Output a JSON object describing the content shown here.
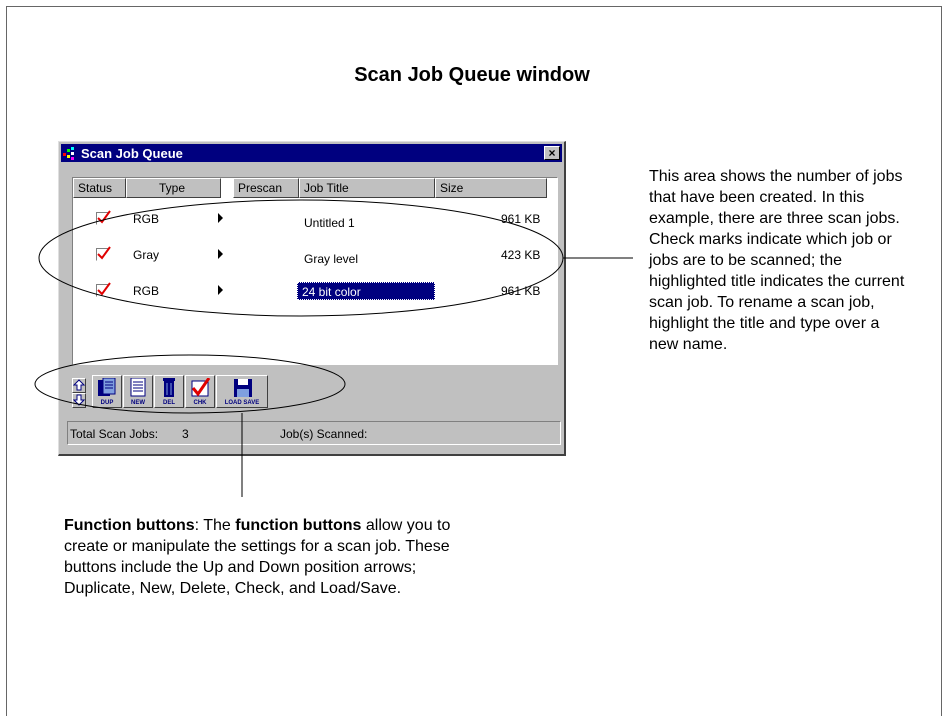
{
  "page_title": "Scan Job Queue window",
  "window": {
    "title": "Scan Job Queue",
    "close_label": "×",
    "columns": [
      "Status",
      "Type",
      "Prescan",
      "Job Title",
      "Size"
    ],
    "rows": [
      {
        "checked": true,
        "type": "RGB",
        "title": "Untitled 1",
        "size": "961 KB"
      },
      {
        "checked": true,
        "type": "Gray",
        "title": "Gray level",
        "size": "423 KB"
      },
      {
        "checked": true,
        "type": "RGB",
        "title": "24 bit color",
        "size": "961 KB",
        "selected": true
      }
    ],
    "toolbar": {
      "dup": "DUP",
      "new": "NEW",
      "del": "DEL",
      "chk": "CHK",
      "load_save": "LOAD SAVE"
    },
    "status": {
      "total_label": "Total Scan Jobs:",
      "total_value": "3",
      "scanned_label": "Job(s) Scanned:"
    }
  },
  "callouts": {
    "right": "This area shows the number of jobs that have been created. In this example, there are three scan jobs. Check marks indicate which job or jobs are to be scanned; the highlighted title indicates the current scan job. To rename a scan job, highlight the title and type over a new name.",
    "bottom_term": "Function buttons",
    "bottom_sep": ": The ",
    "bottom_term2": "function buttons",
    "bottom_rest": " allow you to create or manipulate the settings for a scan job. These buttons include the Up and Down position arrows; Duplicate, New, Delete, Check, and Load/Save."
  },
  "colors": {
    "titlebar": "#00007f",
    "window_bg": "#c0c0c0",
    "check": "#e00000"
  }
}
